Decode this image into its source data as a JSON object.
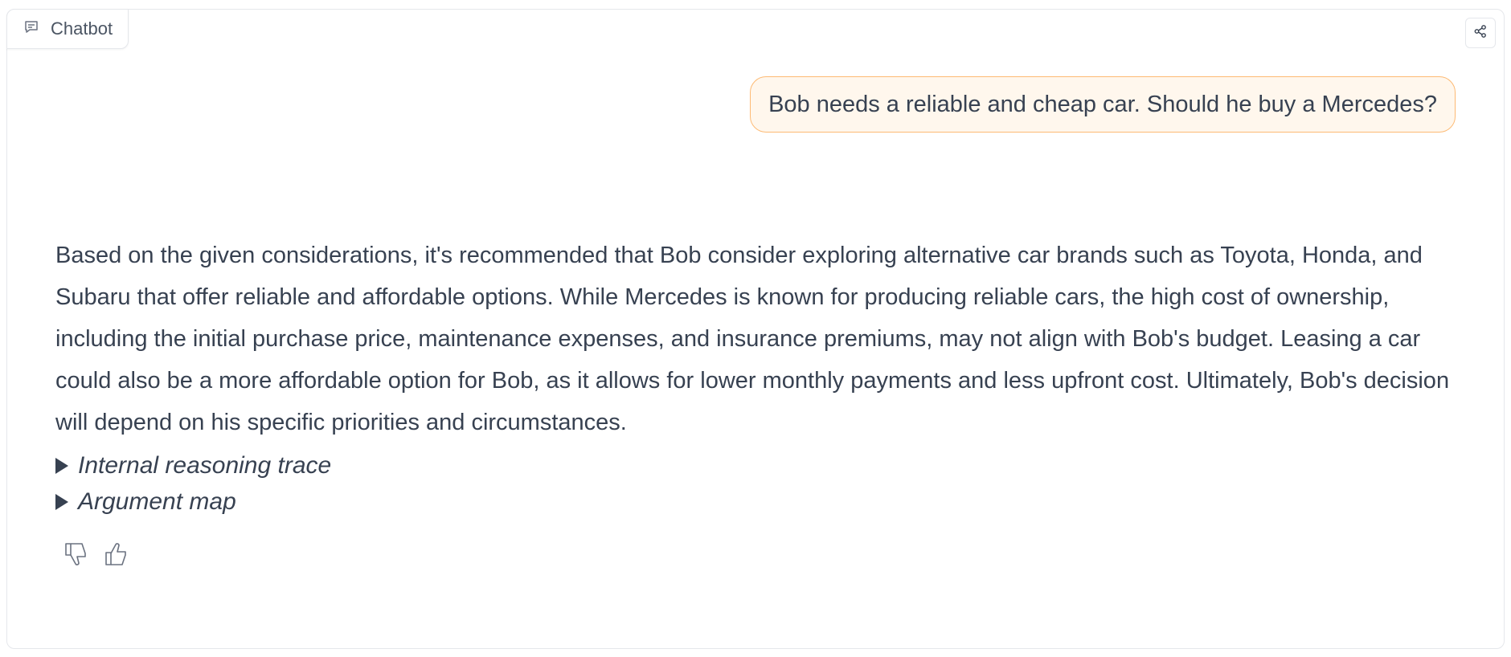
{
  "panel": {
    "label": "Chatbot",
    "label_icon": "chat-icon",
    "share_icon": "share-icon"
  },
  "messages": {
    "user": "Bob needs a reliable and cheap car. Should he buy a Mercedes?",
    "bot": "Based on the given considerations, it's recommended that Bob consider exploring alternative car brands such as Toyota, Honda, and Subaru that offer reliable and affordable options. While Mercedes is known for producing reliable cars, the high cost of ownership, including the initial purchase price, maintenance expenses, and insurance premiums, may not align with Bob's budget. Leasing a car could also be a more affordable option for Bob, as it allows for lower monthly payments and less upfront cost. Ultimately, Bob's decision will depend on his specific priorities and circumstances."
  },
  "details": {
    "reasoning_trace": "Internal reasoning trace",
    "argument_map": "Argument map"
  },
  "feedback": {
    "dislike_icon": "thumbs-down-icon",
    "like_icon": "thumbs-up-icon"
  }
}
